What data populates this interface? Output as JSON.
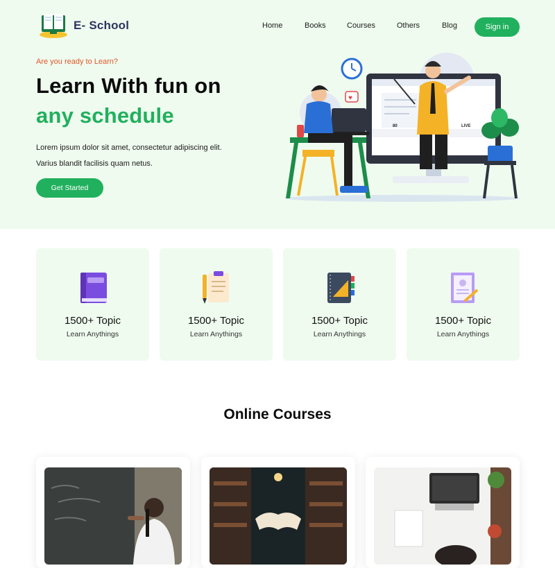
{
  "header": {
    "logo_text": "E- School",
    "nav": [
      "Home",
      "Books",
      "Courses",
      "Others",
      "Blog"
    ],
    "signin_label": "Sign in"
  },
  "hero": {
    "eyebrow": "Are you ready to Learn?",
    "title_line1": "Learn With fun on",
    "title_line2": "any schedule",
    "desc_line1": "Lorem ipsum dolor sit amet, consectetur adipiscing elit.",
    "desc_line2": "Varius blandit facilisis quam netus.",
    "cta_label": "Get Started",
    "screen_stat": "80",
    "screen_live": "LIVE"
  },
  "features": [
    {
      "icon": "purple-book-icon",
      "title": "1500+ Topic",
      "subtitle": "Learn Anythings"
    },
    {
      "icon": "clipboard-pen-icon",
      "title": "1500+ Topic",
      "subtitle": "Learn Anythings"
    },
    {
      "icon": "notebook-ruler-icon",
      "title": "1500+ Topic",
      "subtitle": "Learn Anythings"
    },
    {
      "icon": "certificate-pen-icon",
      "title": "1500+ Topic",
      "subtitle": "Learn Anythings"
    }
  ],
  "courses_section": {
    "title": "Online Courses",
    "cards": [
      {
        "image": "student-writing-on-chalkboard"
      },
      {
        "image": "library-open-book"
      },
      {
        "image": "laptop-desk-top-view"
      }
    ]
  },
  "colors": {
    "brand_green": "#21b05e",
    "hero_bg": "#effbef",
    "eyebrow_orange": "#e0582a",
    "logo_navy": "#2c3560"
  }
}
